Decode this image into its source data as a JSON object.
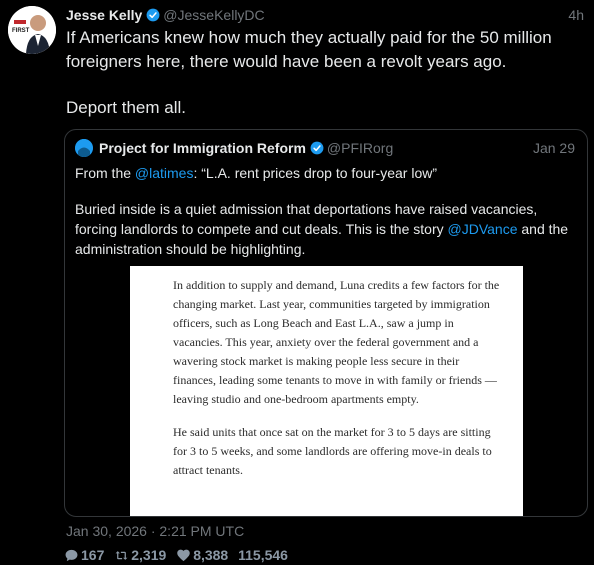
{
  "tweet": {
    "author_name": "Jesse Kelly",
    "author_handle": "@JesseKellyDC",
    "time": "4h",
    "avatar_badge": "FIRST",
    "text_line1": "If Americans knew how much they actually paid for the 50 million foreigners here, there would have been a revolt years ago.",
    "text_line2": "Deport them all.",
    "timestamp": "Jan 30, 2026 · 2:21 PM UTC"
  },
  "quote": {
    "author_name": "Project for Immigration Reform",
    "author_handle": "@PFIRorg",
    "date": "Jan 29",
    "p1_prefix": "From the ",
    "p1_mention": "@latimes",
    "p1_suffix": ": “L.A. rent prices drop to four-year low”",
    "p2_prefix": "Buried inside is a quiet admission that deportations have raised vacancies, forcing landlords to compete and cut deals. This is the story ",
    "p2_mention": "@JDVance",
    "p2_suffix": " and the administration should be highlighting."
  },
  "article": {
    "p1": "In addition to supply and demand, Luna credits a few factors for the changing market. Last year, communities targeted by immigration officers, such as Long Beach and East L.A., saw a jump in vacancies. This year, anxiety over the federal government and a wavering stock market is making people less secure in their finances, leading some tenants to move in with family or friends — leaving studio and one-bedroom apartments empty.",
    "p2": "He said units that once sat on the market for 3 to 5 days are sitting for 3 to 5 weeks, and some landlords are offering move-in deals to attract tenants."
  },
  "stats": {
    "replies": "167",
    "retweets": "2,319",
    "likes": "8,388",
    "views": "115,546"
  },
  "colors": {
    "background": "#000000",
    "text": "#e7e9ea",
    "muted": "#71767b",
    "accent": "#1d9bf0",
    "border": "#333639"
  },
  "icons": {
    "verified": "verified-badge-icon",
    "reply": "reply-icon",
    "retweet": "retweet-icon",
    "like": "heart-icon"
  }
}
